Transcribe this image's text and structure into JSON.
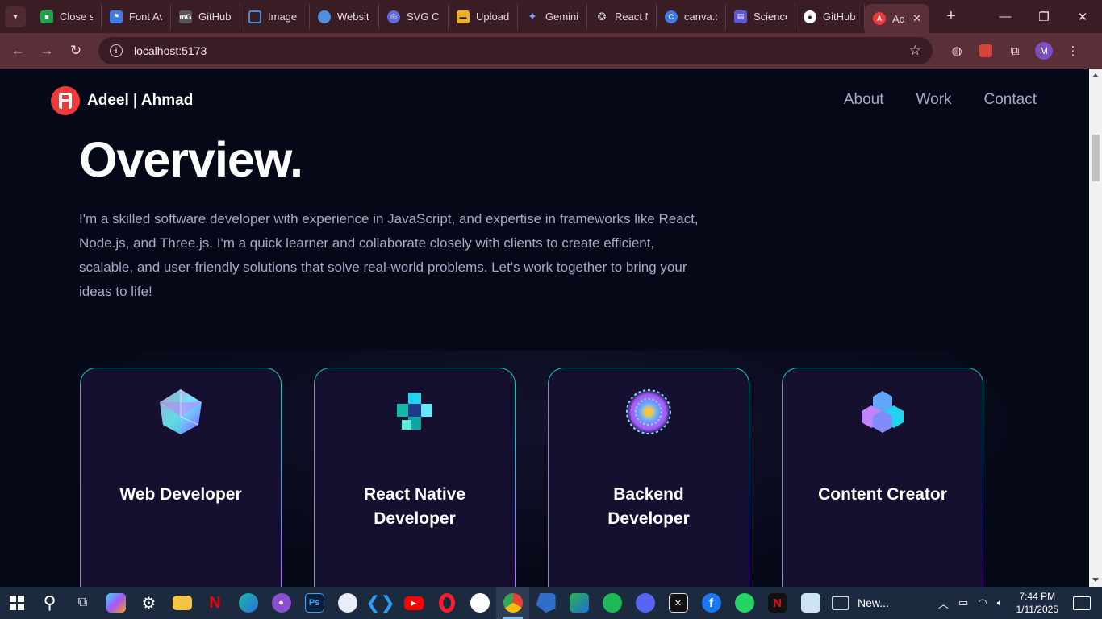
{
  "browser": {
    "tabs": [
      {
        "title": "Close s",
        "icon": "green-square-icon",
        "color": "#1ea446"
      },
      {
        "title": "Font Av",
        "icon": "flag-icon",
        "color": "#3d7be8"
      },
      {
        "title": "GitHub",
        "icon": "mg-icon",
        "color": "#555555"
      },
      {
        "title": "Image",
        "icon": "image-frame-icon",
        "color": "#4a8bd6"
      },
      {
        "title": "Websit",
        "icon": "globe-icon",
        "color": "#4d8fe0"
      },
      {
        "title": "SVG Co",
        "icon": "svg-icon",
        "color": "#5f6ad8"
      },
      {
        "title": "Upload",
        "icon": "upload-icon",
        "color": "#f0b320"
      },
      {
        "title": "Gemini",
        "icon": "gemini-sparkle-icon",
        "color": "#5a8ef0"
      },
      {
        "title": "React N",
        "icon": "openai-icon",
        "color": "#222222"
      },
      {
        "title": "canva.c",
        "icon": "canva-icon",
        "color": "#3d7be8"
      },
      {
        "title": "Science",
        "icon": "science-icon",
        "color": "#5b57d6"
      },
      {
        "title": "GitHub",
        "icon": "github-icon",
        "color": "#222222"
      }
    ],
    "active_tab": {
      "title": "Ad",
      "icon": "adeel-logo-icon",
      "color": "#ef3a3a"
    },
    "url": "localhost:5173",
    "profile_initial": "M"
  },
  "site": {
    "brand_first": "Adeel",
    "brand_sep": " | ",
    "brand_last": "Ahmad",
    "nav": [
      "About",
      "Work",
      "Contact"
    ],
    "heading": "Overview.",
    "intro": "I'm a skilled software developer with experience in JavaScript, and expertise in frameworks like React, Node.js, and Three.js. I'm a quick learner and collaborate closely with clients to create efficient, scalable, and user-friendly solutions that solve real-world problems. Let's work together to bring your ideas to life!",
    "cards": [
      {
        "title": "Web Developer",
        "icon": "crystal-polyhedron-icon"
      },
      {
        "title": "React Native Developer",
        "icon": "cube-blocks-icon"
      },
      {
        "title": "Backend Developer",
        "icon": "sphere-mosaic-icon"
      },
      {
        "title": "Content Creator",
        "icon": "hexagon-cluster-icon"
      }
    ]
  },
  "taskbar": {
    "news_label": "New...",
    "time": "7:44 PM",
    "date": "1/11/2025"
  },
  "colors": {
    "bg": "#050816",
    "card_bg": "#151030",
    "accent_green": "#00cea8",
    "accent_purple": "#bf61ff",
    "text_secondary": "#aaa6c3"
  }
}
